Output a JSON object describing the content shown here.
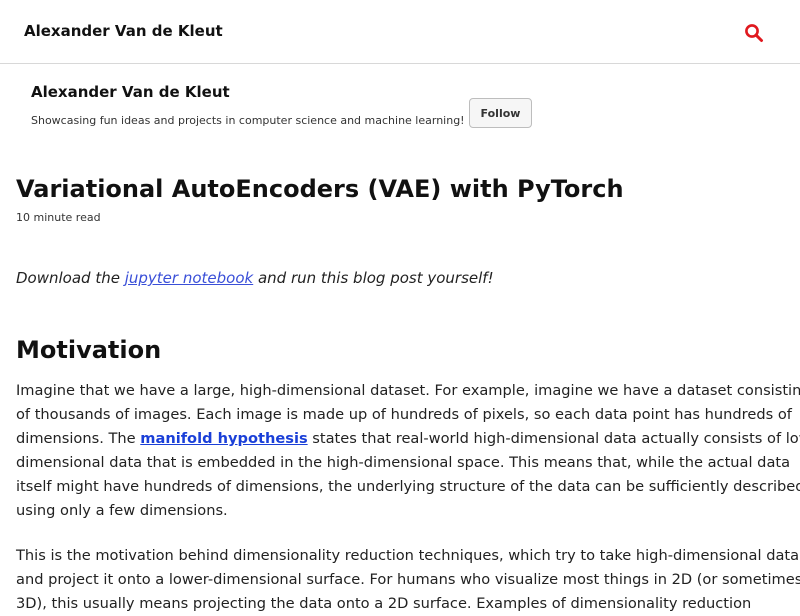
{
  "masthead": {
    "site_title": "Alexander Van de Kleut"
  },
  "author": {
    "name": "Alexander Van de Kleut",
    "bio": "Showcasing fun ideas and projects in computer science and machine learning!",
    "follow_label": "Follow"
  },
  "post": {
    "title": "Variational AutoEncoders (VAE) with PyTorch",
    "read_time": "10 minute read",
    "download": {
      "before": "Download the ",
      "link_text": "jupyter notebook",
      "after": " and run this blog post yourself!"
    },
    "section_heading": "Motivation",
    "paragraph_1": {
      "line_1": "Imagine that we have a large, high-dimensional dataset. For example, imagine we have a dataset consisting",
      "line_2": "of thousands of images. Each image is made up of hundreds of pixels, so each data point has hundreds of",
      "line_3_before": "dimensions. The ",
      "line_3_link": "manifold hypothesis",
      "line_3_after": " states that real-world high-dimensional data actually consists of low-",
      "line_4": "dimensional data that is embedded in the high-dimensional space. This means that, while the actual data",
      "line_5": "itself might have hundreds of dimensions, the underlying structure of the data can be sufficiently described",
      "line_6": "using only a few dimensions."
    },
    "paragraph_2": {
      "line_1": "This is the motivation behind dimensionality reduction techniques, which try to take high-dimensional data",
      "line_2": "and project it onto a lower-dimensional surface. For humans who visualize most things in 2D (or sometimes",
      "line_3": "3D), this usually means projecting the data onto a 2D surface. Examples of dimensionality reduction"
    }
  },
  "icons": {
    "search": "search-icon"
  },
  "colors": {
    "search_icon": "#e0191f",
    "link": "#3a4fd8",
    "border": "#d8d8d8"
  }
}
